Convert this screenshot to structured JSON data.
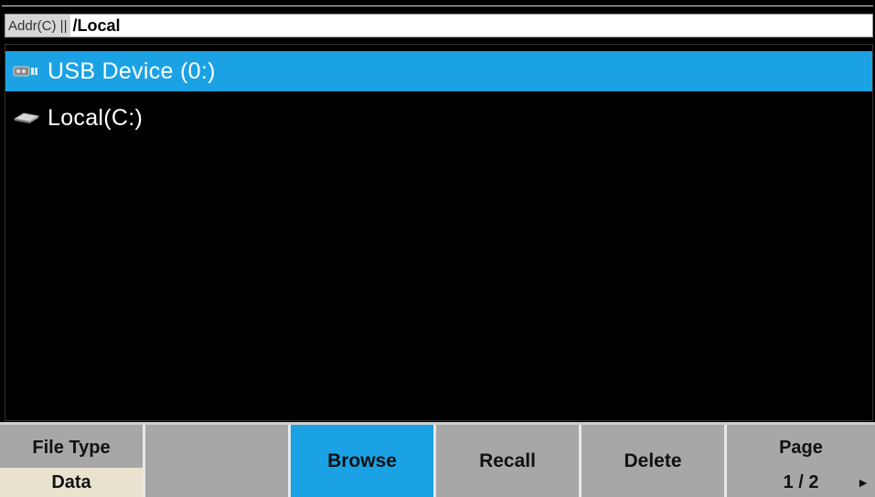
{
  "address": {
    "prefix": "Addr(C) ||",
    "path": "/Local"
  },
  "file_list": [
    {
      "label": "USB Device (0:)",
      "icon": "usb-drive-icon",
      "selected": true
    },
    {
      "label": "Local(C:)",
      "icon": "disk-drive-icon",
      "selected": false
    }
  ],
  "softkeys": {
    "file_type": {
      "label": "File Type",
      "value": "Data"
    },
    "blank": "",
    "browse": "Browse",
    "recall": "Recall",
    "delete": "Delete",
    "page": {
      "label": "Page",
      "value": "1 / 2",
      "arrow": "►"
    }
  },
  "colors": {
    "selection": "#1ba2e4",
    "softkey": "#a7a7a7",
    "value_bg": "#e8e2cf"
  }
}
